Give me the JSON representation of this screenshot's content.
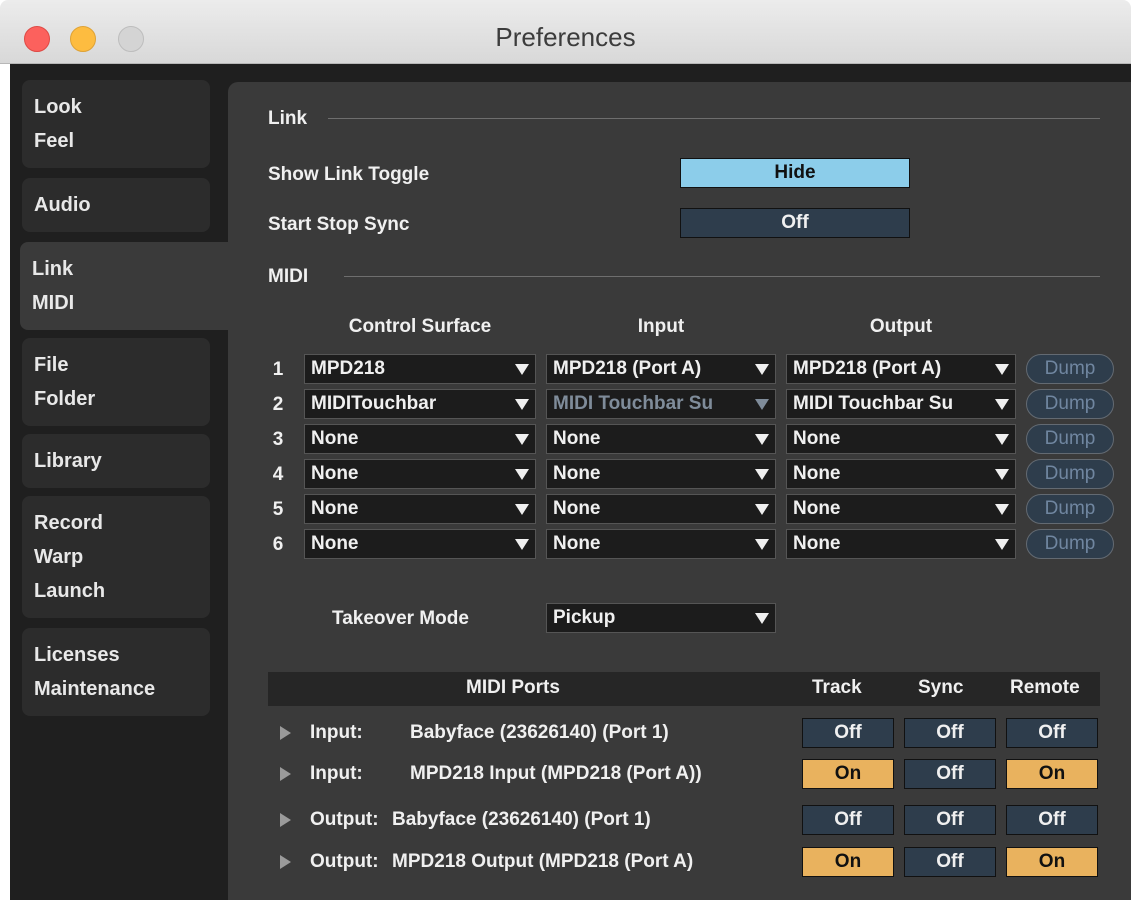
{
  "window": {
    "title": "Preferences"
  },
  "sidebar": {
    "groups": [
      {
        "items": [
          "Look",
          "Feel"
        ]
      },
      {
        "items": [
          "Audio"
        ]
      },
      {
        "items": [
          "Link",
          "MIDI"
        ],
        "active": true
      },
      {
        "items": [
          "File",
          "Folder"
        ]
      },
      {
        "items": [
          "Library"
        ]
      },
      {
        "items": [
          "Record",
          "Warp",
          "Launch"
        ]
      },
      {
        "items": [
          "Licenses",
          "Maintenance"
        ]
      }
    ]
  },
  "link": {
    "section_label": "Link",
    "show_link_toggle": {
      "label": "Show Link Toggle",
      "value": "Hide"
    },
    "start_stop_sync": {
      "label": "Start Stop Sync",
      "value": "Off"
    }
  },
  "midi": {
    "section_label": "MIDI",
    "headers": {
      "control_surface": "Control Surface",
      "input": "Input",
      "output": "Output"
    },
    "dump_label": "Dump",
    "rows": [
      {
        "num": "1",
        "surface": "MPD218",
        "input": "MPD218 (Port A)",
        "output": "MPD218 (Port A)"
      },
      {
        "num": "2",
        "surface": "MIDITouchbar",
        "input": "MIDI Touchbar Su",
        "output": "MIDI Touchbar Su"
      },
      {
        "num": "3",
        "surface": "None",
        "input": "None",
        "output": "None"
      },
      {
        "num": "4",
        "surface": "None",
        "input": "None",
        "output": "None"
      },
      {
        "num": "5",
        "surface": "None",
        "input": "None",
        "output": "None"
      },
      {
        "num": "6",
        "surface": "None",
        "input": "None",
        "output": "None"
      }
    ],
    "takeover": {
      "label": "Takeover Mode",
      "value": "Pickup"
    }
  },
  "ports": {
    "headers": {
      "midi_ports": "MIDI Ports",
      "track": "Track",
      "sync": "Sync",
      "remote": "Remote"
    },
    "rows": [
      {
        "kind": "Input:",
        "name": "Babyface (23626140) (Port 1)",
        "track": "Off",
        "sync": "Off",
        "remote": "Off"
      },
      {
        "kind": "Input:",
        "name": "MPD218 Input (MPD218 (Port A))",
        "track": "On",
        "sync": "Off",
        "remote": "On"
      },
      {
        "kind": "Output:",
        "name": "Babyface (23626140) (Port 1)",
        "track": "Off",
        "sync": "Off",
        "remote": "Off"
      },
      {
        "kind": "Output:",
        "name": "MPD218 Output (MPD218 (Port A)",
        "track": "On",
        "sync": "Off",
        "remote": "On"
      }
    ]
  },
  "colors": {
    "on": "#e9b25e",
    "off": "#2e3d4c",
    "accent_blue": "#8ccdea",
    "panel": "#3a3a3a",
    "background": "#1f1f1f"
  }
}
